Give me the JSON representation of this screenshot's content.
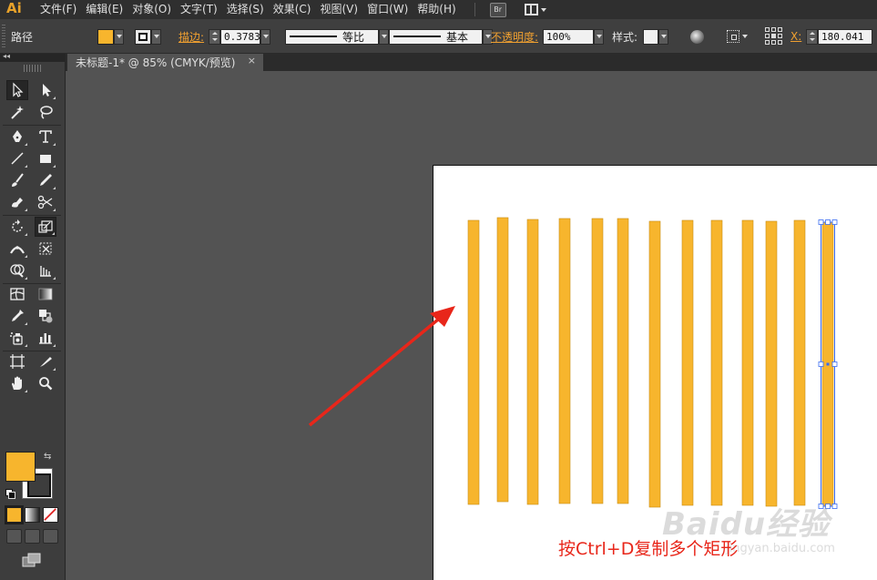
{
  "app": {
    "logo": "Ai",
    "accent_color": "#e8a22a"
  },
  "menubar": {
    "items": [
      "文件(F)",
      "编辑(E)",
      "对象(O)",
      "文字(T)",
      "选择(S)",
      "效果(C)",
      "视图(V)",
      "窗口(W)",
      "帮助(H)"
    ],
    "bridge_label": "Br"
  },
  "controlbar": {
    "selection_type": "路径",
    "fill_color": "#f7b52d",
    "stroke_label": "描边:",
    "stroke_weight": "0.3783",
    "variable_width_label": "等比",
    "brush_label": "基本",
    "opacity_label": "不透明度:",
    "opacity_value": "100%",
    "style_label": "样式:",
    "x_label": "X:",
    "x_value": "180.041"
  },
  "document": {
    "tab_title": "未标题-1* @ 85% (CMYK/预览)",
    "close_glyph": "×"
  },
  "toolbox": {
    "fill_color": "#f7b52d",
    "stroke_color": "#111111"
  },
  "artwork": {
    "bar_color": "#f7b52d",
    "bar_count": 13,
    "selection_color": "#3a6cf0"
  },
  "annotation": {
    "caption": "按Ctrl+D复制多个矩形",
    "caption_color": "#e8261a",
    "arrow_color": "#e8261a"
  },
  "watermark": {
    "text": "Baidu经验",
    "url": "jingyan.baidu.com"
  }
}
